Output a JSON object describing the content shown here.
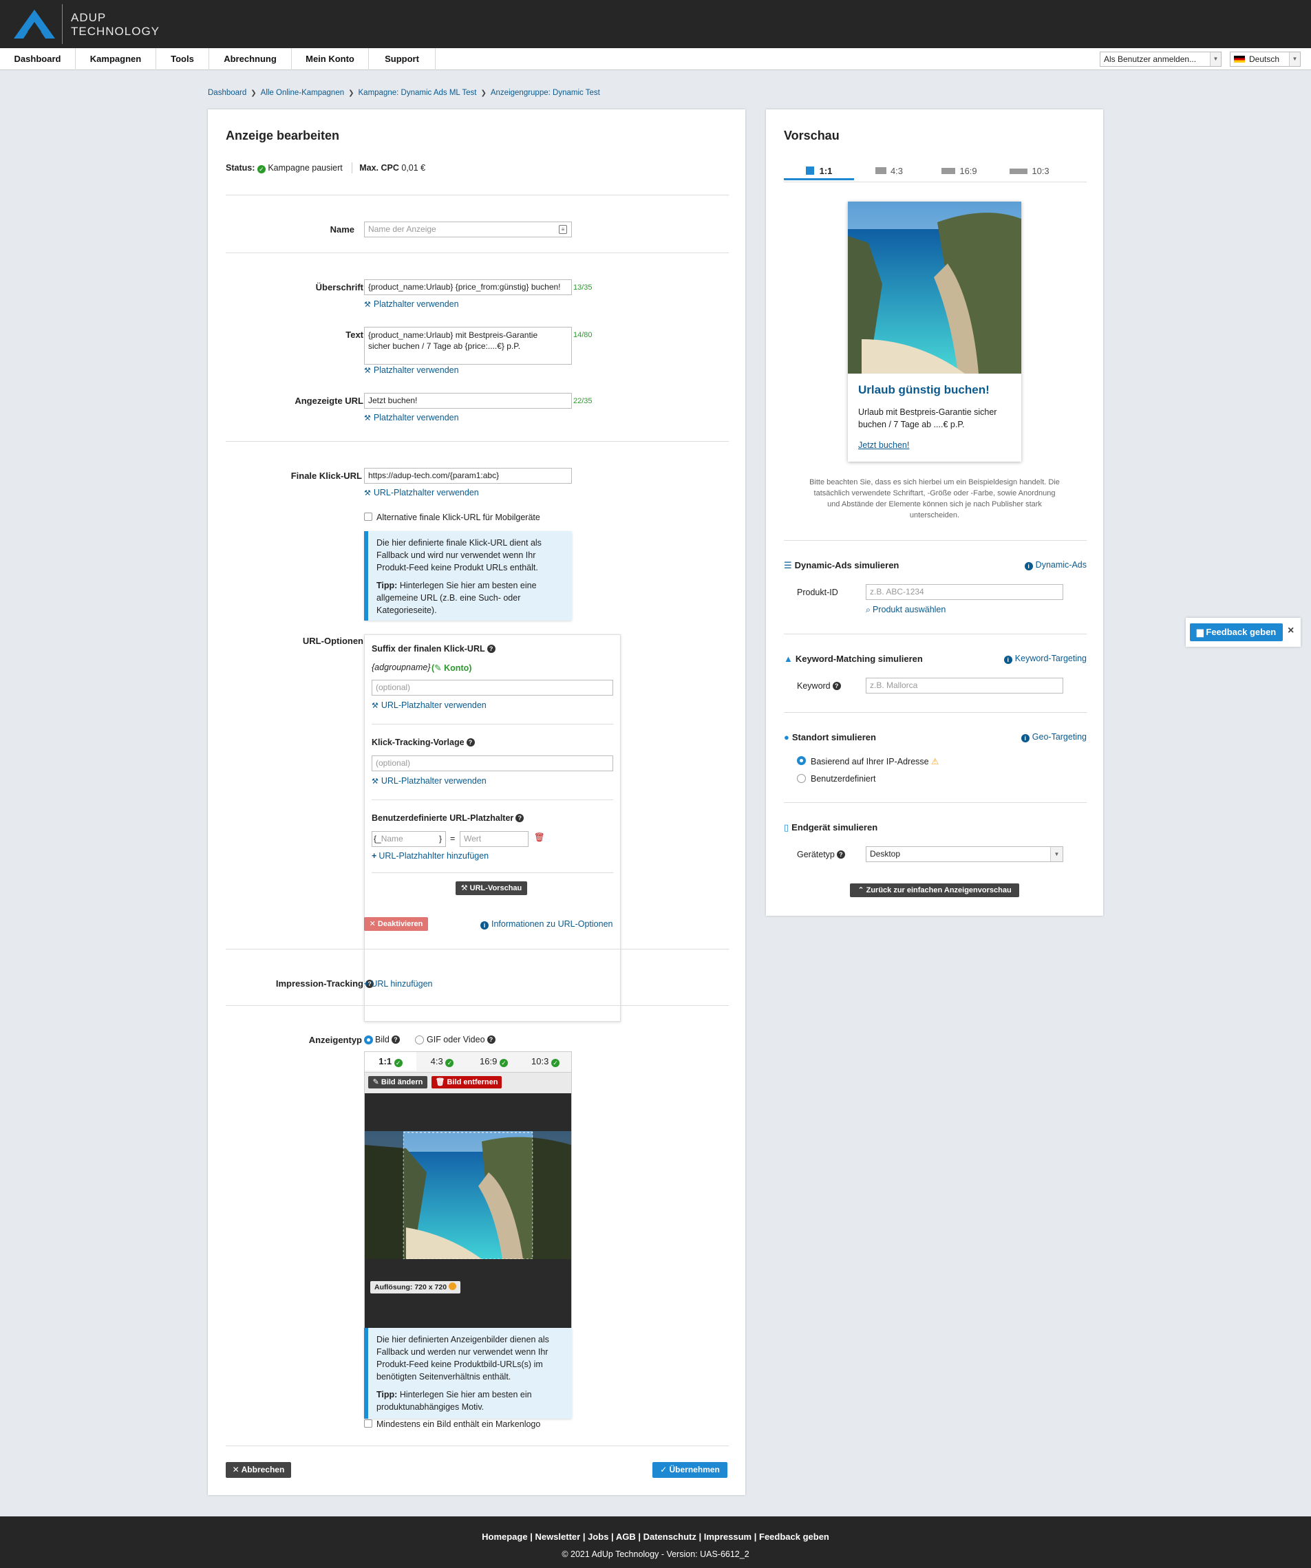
{
  "header": {
    "brand_line1": "ADUP",
    "brand_line2": "TECHNOLOGY",
    "login_as": "Als Benutzer anmelden...",
    "language": "Deutsch"
  },
  "nav": {
    "items": [
      "Dashboard",
      "Kampagnen",
      "Tools",
      "Abrechnung",
      "Mein Konto",
      "Support"
    ]
  },
  "breadcrumb": [
    "Dashboard",
    "Alle Online-Kampagnen",
    "Kampagne: Dynamic Ads ML Test",
    "Anzeigengruppe: Dynamic Test"
  ],
  "form": {
    "title": "Anzeige bearbeiten",
    "status_label": "Status:",
    "status_value": "Kampagne pausiert",
    "cpc_label": "Max. CPC",
    "cpc_value": "0,01 €",
    "name_label": "Name",
    "name_placeholder": "Name der Anzeige",
    "headline_label": "Überschrift",
    "headline_value": "{product_name:Urlaub} {price_from:günstig} buchen!",
    "headline_count": "13/35",
    "placeholder_link": "Platzhalter verwenden",
    "text_label": "Text",
    "text_value_line1": "{product_name:Urlaub} mit Bestpreis-Garantie",
    "text_value_line2": "sicher buchen / 7 Tage ab {price:....€} p.P.",
    "text_count": "14/80",
    "display_url_label": "Angezeigte URL",
    "display_url_value": "Jetzt buchen!",
    "display_url_count": "22/35",
    "final_url_label": "Finale Klick-URL",
    "final_url_value": "https://adup-tech.com/{param1:abc}",
    "url_placeholder_link": "URL-Platzhalter verwenden",
    "mobile_url_checkbox": "Alternative finale Klick-URL für Mobilgeräte",
    "info1_text": "Die hier definierte finale Klick-URL dient als Fallback und wird nur verwendet wenn Ihr Produkt-Feed keine Produkt URLs enthält.",
    "info1_tip_label": "Tipp:",
    "info1_tip": "Hinterlegen Sie hier am besten eine allgemeine URL (z.B. eine Such- oder Kategorieseite).",
    "url_options_label": "URL-Optionen",
    "suffix_title": "Suffix der finalen Klick-URL",
    "suffix_value": "{adgroupname}",
    "suffix_konto": "Konto",
    "optional_placeholder": "(optional)",
    "tracking_title": "Klick-Tracking-Vorlage",
    "custom_title": "Benutzerdefinierte URL-Platzhalter",
    "custom_name_placeholder": "Name",
    "custom_value_placeholder": "Wert",
    "add_placeholder": "URL-Platzhahlter hinzufügen",
    "url_preview_btn": "URL-Vorschau",
    "deactivate_btn": "Deaktivieren",
    "url_options_info": "Informationen zu URL-Optionen",
    "impression_label": "Impression-Tracking",
    "add_url": "URL hinzufügen",
    "adtype_label": "Anzeigentyp",
    "adtype_image": "Bild",
    "adtype_gif": "GIF oder Video",
    "ratios": [
      "1:1",
      "4:3",
      "16:9",
      "10:3"
    ],
    "change_image": "Bild ändern",
    "remove_image": "Bild entfernen",
    "resolution": "Auflösung: 720 x 720",
    "brand_logo_checkbox": "Mindestens ein Bild enthält ein Markenlogo",
    "info2_text": "Die hier definierten Anzeigenbilder dienen als Fallback und werden nur verwendet wenn Ihr Produkt-Feed keine Produktbild-URLs(s) im benötigten Seitenverhältnis enthält.",
    "info2_tip_label": "Tipp:",
    "info2_tip": "Hinterlegen Sie hier am besten ein produktunabhängiges Motiv.",
    "cancel_btn": "Abbrechen",
    "apply_btn": "Übernehmen"
  },
  "preview": {
    "title": "Vorschau",
    "tabs": [
      "1:1",
      "4:3",
      "16:9",
      "10:3"
    ],
    "ad_title": "Urlaub günstig buchen!",
    "ad_text": "Urlaub mit Bestpreis-Garantie sicher buchen / 7 Tage ab ....€ p.P.",
    "ad_cta": "Jetzt buchen!",
    "note": "Bitte beachten Sie, dass es sich hierbei um ein Beispieldesign handelt. Die tatsächlich verwendete Schriftart, -Größe oder -Farbe, sowie Anordnung und Abstände der Elemente können sich je nach Publisher stark unterscheiden.",
    "dyn_title": "Dynamic-Ads simulieren",
    "dyn_link": "Dynamic-Ads",
    "product_id_label": "Produkt-ID",
    "product_id_placeholder": "z.B. ABC-1234",
    "choose_product": "Produkt auswählen",
    "kw_title": "Keyword-Matching simulieren",
    "kw_link": "Keyword-Targeting",
    "kw_label": "Keyword",
    "kw_placeholder": "z.B. Mallorca",
    "geo_title": "Standort simulieren",
    "geo_link": "Geo-Targeting",
    "geo_opt1": "Basierend auf Ihrer IP-Adresse",
    "geo_opt2": "Benutzerdefiniert",
    "dev_title": "Endgerät simulieren",
    "dev_label": "Gerätetyp",
    "dev_value": "Desktop",
    "back_btn": "Zurück zur einfachen Anzeigenvorschau"
  },
  "feedback": {
    "label": "Feedback geben",
    "close": "×"
  },
  "footer": {
    "links": [
      "Homepage",
      "Newsletter",
      "Jobs",
      "AGB",
      "Datenschutz",
      "Impressum",
      "Feedback geben"
    ],
    "copyright": "© 2021 AdUp Technology - Version: UAS-6612_2"
  },
  "colors": {
    "accent": "#1e88d2",
    "link": "#0b5a8f",
    "success": "#2a9a2a",
    "danger": "#c10c0c",
    "header": "#262626"
  }
}
